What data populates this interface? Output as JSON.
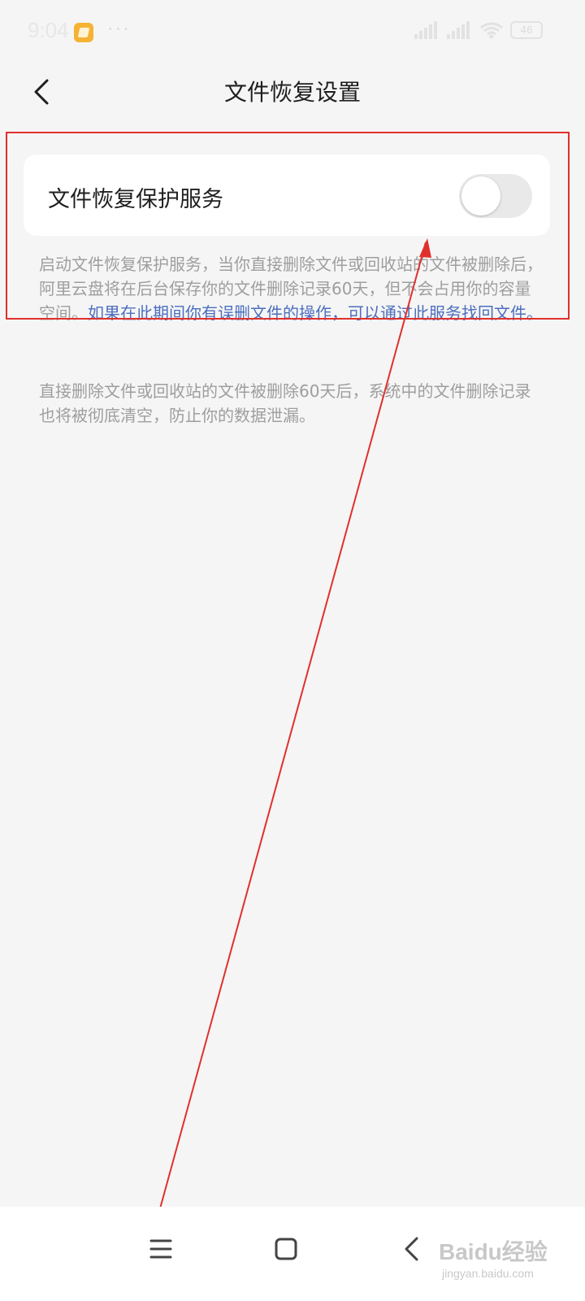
{
  "status_bar": {
    "time": "9:04",
    "more": "···",
    "battery": "46",
    "icons": [
      "app-notification-icon",
      "signal-icon",
      "signal-icon",
      "wifi-icon",
      "battery-icon"
    ]
  },
  "header": {
    "title": "文件恢复设置",
    "back_icon": "chevron-left-icon"
  },
  "setting": {
    "label": "文件恢复保护服务",
    "enabled": false
  },
  "description_1": {
    "text": "启动文件恢复保护服务，当你直接删除文件或回收站的文件被删除后，阿里云盘将在后台保存你的文件删除记录60天，但不会占用你的容量空间。",
    "link": "如果在此期间你有误删文件的操作，可以通过此服务找回文件。"
  },
  "description_2": {
    "text": "直接删除文件或回收站的文件被删除60天后，系统中的文件删除记录也将被彻底清空，防止你的数据泄漏。"
  },
  "nav_bar": {
    "icons": [
      "menu-icon",
      "home-square-icon",
      "back-icon"
    ]
  },
  "watermark": {
    "logo": "Baidu经验",
    "sub": "jingyan.baidu.com"
  },
  "colors": {
    "background": "#f5f5f5",
    "card": "#ffffff",
    "link": "#4c6fbf",
    "annotation": "#e0302c",
    "muted_text": "#9e9e9e"
  }
}
